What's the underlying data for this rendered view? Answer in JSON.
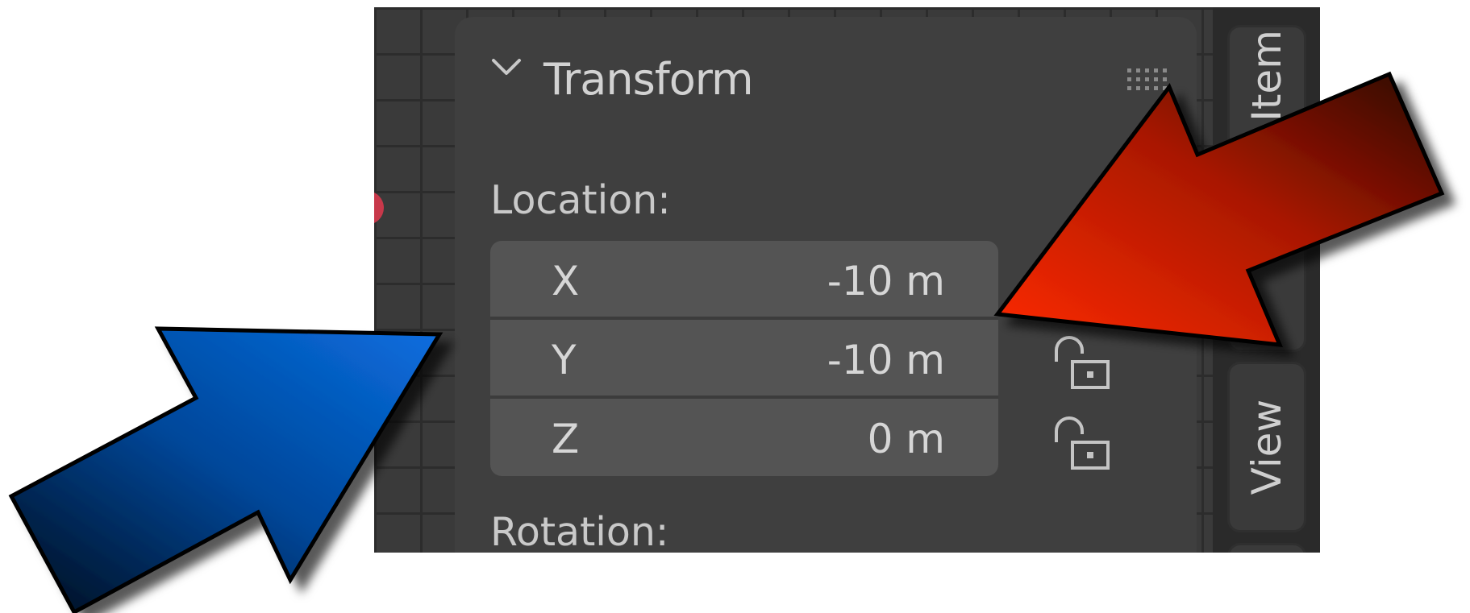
{
  "panel": {
    "title": "Transform",
    "location_label": "Location:",
    "rotation_label": "Rotation:",
    "location_fields": [
      {
        "axis": "X",
        "value": "-10 m"
      },
      {
        "axis": "Y",
        "value": "-10 m"
      },
      {
        "axis": "Z",
        "value": "0 m"
      }
    ]
  },
  "side_tabs": [
    {
      "label": "Item"
    },
    {
      "label": "View"
    }
  ],
  "icons": {
    "chevron": "chevron-down-icon",
    "grip": "drag-grip-icon",
    "lock": "unlocked-padlock-icon"
  },
  "colors": {
    "panel_bg": "#3f3f3f",
    "field_bg": "#545454",
    "red_arrow": "#ff2200",
    "blue_arrow": "#0066cc"
  }
}
